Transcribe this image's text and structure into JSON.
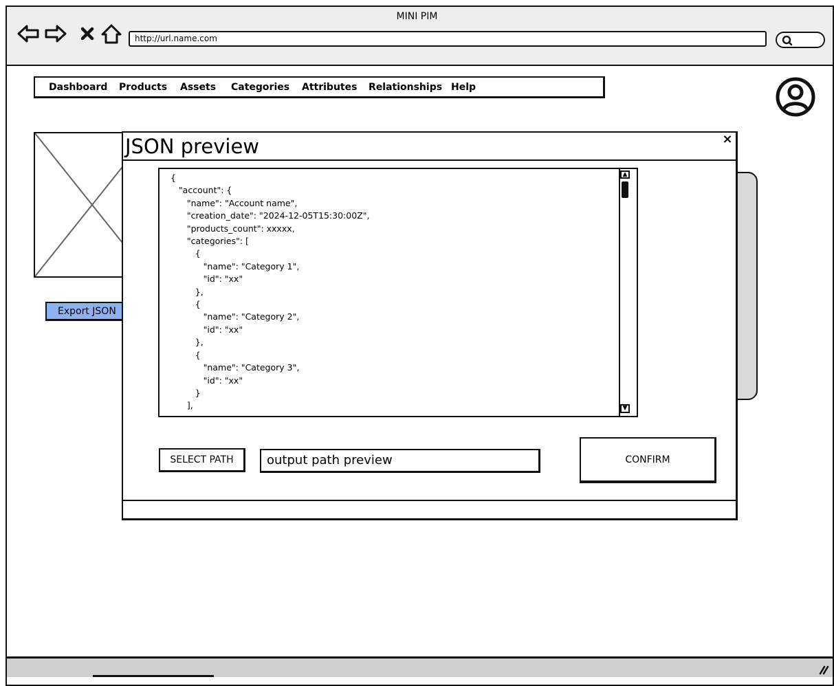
{
  "window": {
    "title": "MINI PIM"
  },
  "browser": {
    "url": "http://url.name.com",
    "nav_icons": [
      "back-arrow-icon",
      "forward-arrow-icon",
      "close-x-icon",
      "home-icon"
    ],
    "search_icon": "search-icon"
  },
  "menu": {
    "items": [
      {
        "label": "Dashboard"
      },
      {
        "label": "Products"
      },
      {
        "label": "Assets"
      },
      {
        "label": "Categories"
      },
      {
        "label": "Attributes"
      },
      {
        "label": "Relationships"
      },
      {
        "label": "Help"
      }
    ]
  },
  "background": {
    "export_button": "Export JSON"
  },
  "modal": {
    "title": "JSON preview",
    "close_glyph": "×",
    "json_preview": "{\n   \"account\": {\n      \"name\": \"Account name\",\n      \"creation_date\": \"2024-12-05T15:30:00Z\",\n      \"products_count\": xxxxx,\n      \"categories\": [\n         {\n            \"name\": \"Category 1\",\n            \"id\": \"xx\"\n         },\n         {\n            \"name\": \"Category 2\",\n            \"id\": \"xx\"\n         },\n         {\n            \"name\": \"Category 3\",\n            \"id\": \"xx\"\n         }\n      ],",
    "select_path_label": "SELECT PATH",
    "output_path_value": "output path preview",
    "confirm_label": "CONFIRM"
  },
  "colors": {
    "export_button_bg": "#8fb1f2",
    "chrome_bg": "#eeeeee",
    "status_bar_bg": "#cfcfcf"
  }
}
